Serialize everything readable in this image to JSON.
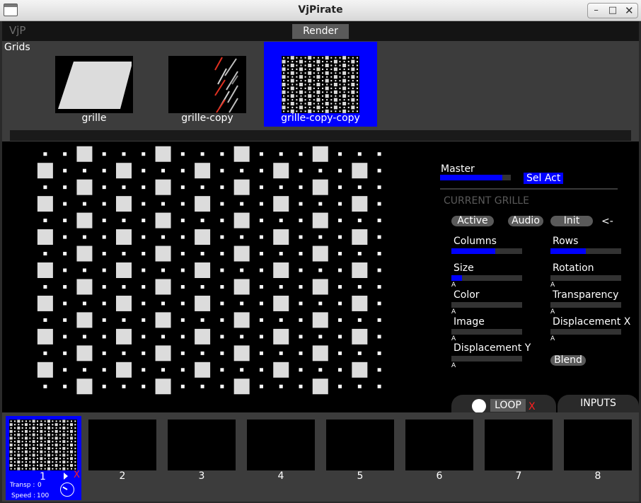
{
  "window": {
    "title": "VjPirate"
  },
  "window_buttons": {
    "minimize": "–",
    "maximize": "□",
    "close": "✕"
  },
  "app": {
    "logo": "VjP",
    "render_label": "Render"
  },
  "grids": {
    "label": "Grids",
    "items": [
      {
        "name": "grille",
        "selected": false
      },
      {
        "name": "grille-copy",
        "selected": false
      },
      {
        "name": "grille-copy-copy",
        "selected": true
      }
    ]
  },
  "preview": {
    "columns": 18,
    "rows": 15
  },
  "master": {
    "label": "Master",
    "level": 0.88,
    "sel_act": "Sel Act"
  },
  "current": {
    "title": "CURRENT GRILLE",
    "buttons": {
      "active": "Active",
      "audio": "Audio",
      "init": "Init",
      "back": "<-"
    },
    "params": {
      "columns": {
        "label": "Columns",
        "level": 0.62
      },
      "rows": {
        "label": "Rows",
        "level": 0.5
      },
      "size": {
        "label": "Size",
        "level": 0.15,
        "auto": "A"
      },
      "rotation": {
        "label": "Rotation",
        "level": 0,
        "auto": "A"
      },
      "color": {
        "label": "Color",
        "level": 0,
        "auto": "A"
      },
      "transparency": {
        "label": "Transparency",
        "level": 0,
        "auto": "A"
      },
      "image": {
        "label": "Image",
        "level": 0,
        "auto": "A"
      },
      "displacement_x": {
        "label": "Displacement X",
        "level": 0,
        "auto": "A"
      },
      "displacement_y": {
        "label": "Displacement Y",
        "level": 0,
        "auto": "A"
      }
    },
    "blend": "Blend"
  },
  "tabs": {
    "loop": "LOOP",
    "loop_close": "X",
    "inputs": "INPUTS"
  },
  "slots": {
    "items": [
      "1",
      "2",
      "3",
      "4",
      "5",
      "6",
      "7",
      "8"
    ],
    "active": {
      "close": "X",
      "transp_label": "Transp :",
      "transp_value": "0",
      "speed_label": "Speed :",
      "speed_value": "100"
    }
  },
  "colors": {
    "accent": "#0000ff",
    "close_red": "#ff2020",
    "panel": "#3c3c3c"
  }
}
